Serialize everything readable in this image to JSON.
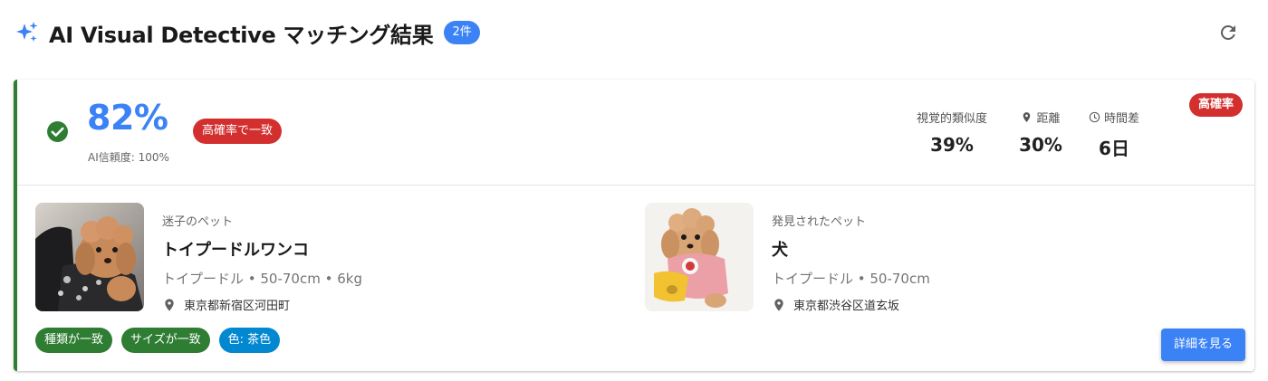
{
  "header": {
    "title": "AI Visual Detective マッチング結果",
    "count_badge": "2件"
  },
  "match": {
    "score": "82%",
    "confidence": "AI信頼度: 100%",
    "match_label": "高確率で一致",
    "probability_badge": "高確率",
    "metrics": [
      {
        "label": "視覚的類似度",
        "value": "39%"
      },
      {
        "label": "距離",
        "value": "30%"
      },
      {
        "label": "時間差",
        "value": "6日"
      }
    ]
  },
  "lost_pet": {
    "section_label": "迷子のペット",
    "name": "トイプードルワンコ",
    "details": "トイプードル • 50-70cm • 6kg",
    "location": "東京都新宿区河田町"
  },
  "found_pet": {
    "section_label": "発見されたペット",
    "name": "犬",
    "details": "トイプードル • 50-70cm",
    "location": "東京都渋谷区道玄坂"
  },
  "tags": [
    "種類が一致",
    "サイズが一致",
    "色: 茶色"
  ],
  "detail_button": "詳細を見る",
  "colors": {
    "accent": "#3b82f6",
    "success": "#2e7d32",
    "danger": "#d32f2f",
    "info": "#0288d1"
  },
  "icons": [
    "sparkle-icon",
    "refresh-icon",
    "check-circle-icon",
    "location-pin-icon",
    "clock-icon"
  ]
}
